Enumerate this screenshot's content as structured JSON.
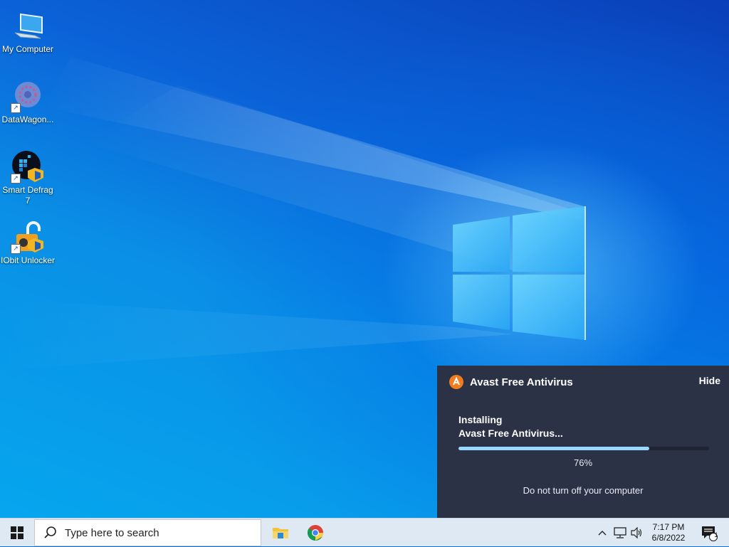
{
  "desktop": {
    "icons": [
      {
        "label": "My Computer",
        "icon": "computer-icon"
      },
      {
        "label": "DataWagon...",
        "icon": "datawagon-icon"
      },
      {
        "label": "Smart Defrag 7",
        "icon": "smart-defrag-icon"
      },
      {
        "label": "IObit Unlocker",
        "icon": "iobit-unlocker-icon"
      }
    ]
  },
  "avast": {
    "title": "Avast Free Antivirus",
    "hide_label": "Hide",
    "status_line1": "Installing",
    "status_line2": "Avast Free Antivirus...",
    "progress": 0.76,
    "progress_text": "76%",
    "warning": "Do not turn off your computer",
    "brand_color": "#f27d1f"
  },
  "taskbar": {
    "search_placeholder": "Type here to search",
    "pinned": [
      "file-explorer-icon",
      "chrome-icon"
    ],
    "clock_time": "7:17 PM",
    "clock_date": "6/8/2022",
    "notification_count": "1"
  }
}
